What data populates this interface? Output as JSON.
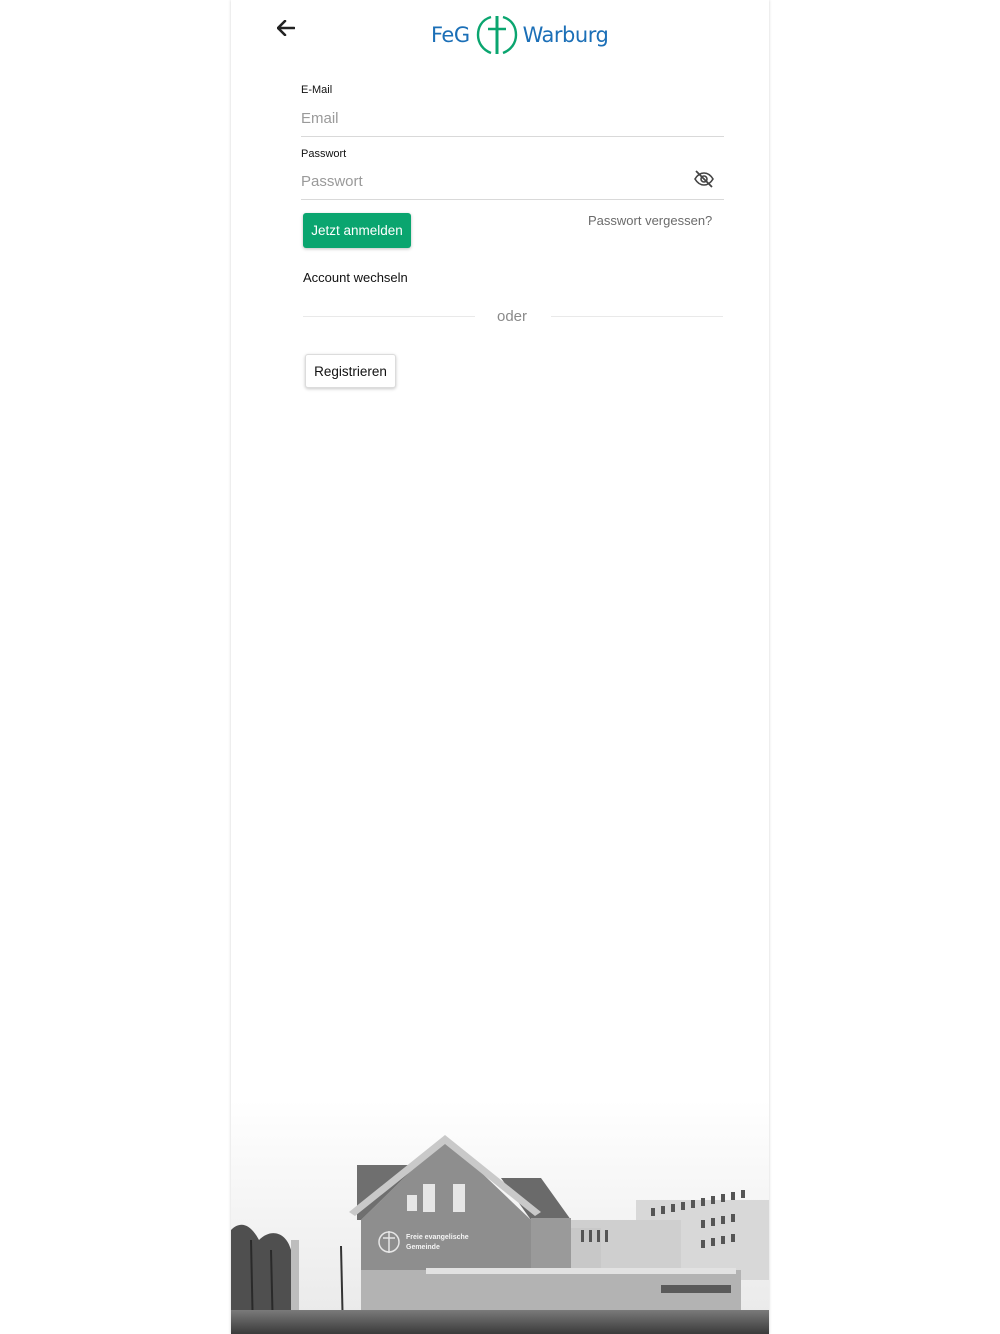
{
  "header": {
    "back_icon": "arrow-left-icon",
    "logo": {
      "text_left": "FeG",
      "text_right": "Warburg",
      "cross_icon": "cross-circle-icon",
      "colors": {
        "text": "#1b6fb7",
        "cross": "#0aa56f"
      }
    }
  },
  "form": {
    "email": {
      "label": "E-Mail",
      "placeholder": "Email",
      "value": ""
    },
    "password": {
      "label": "Passwort",
      "placeholder": "Passwort",
      "value": "",
      "toggle_icon": "eye-off-icon"
    },
    "login_button": "Jetzt anmelden",
    "forgot_link": "Passwort vergessen?",
    "switch_account": "Account wechseln",
    "divider_text": "oder",
    "register_button": "Registrieren"
  },
  "footer_image": {
    "description_icon": "church-building-photo",
    "sign_line1": "Freie evangelische",
    "sign_line2": "Gemeinde"
  },
  "colors": {
    "accent": "#0aa56f",
    "text": "#111111",
    "muted": "#6b6b6b",
    "divider": "#e9e9e9"
  }
}
